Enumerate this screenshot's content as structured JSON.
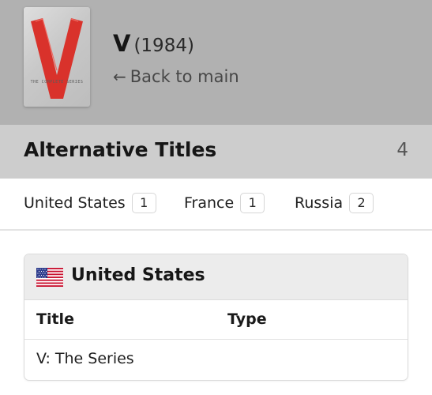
{
  "show": {
    "poster_caption": "THE COMPLETE SERIES",
    "title": "V",
    "year": "(1984)",
    "back_label": "Back to main",
    "back_icon": "arrow-left-icon"
  },
  "section": {
    "title": "Alternative Titles",
    "count": "4"
  },
  "tabs": [
    {
      "label": "United States",
      "count": "1"
    },
    {
      "label": "France",
      "count": "1"
    },
    {
      "label": "Russia",
      "count": "2"
    }
  ],
  "card": {
    "country": "United States",
    "flag_icon": "us-flag-icon",
    "columns": [
      "Title",
      "Type"
    ],
    "rows": [
      {
        "title": "V: The Series",
        "type": ""
      }
    ]
  },
  "colors": {
    "header_bg": "#b1b1b1",
    "section_bg": "#cdcdcd",
    "poster_v": "#d9322b"
  }
}
